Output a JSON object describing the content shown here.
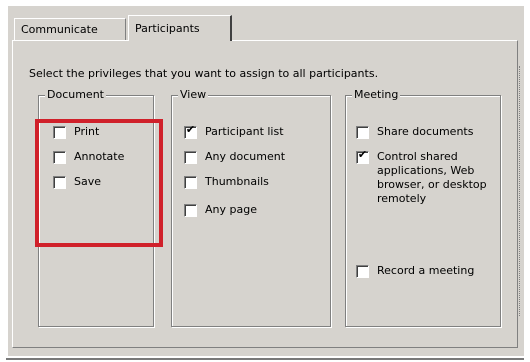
{
  "tabs": [
    {
      "label": "Communicate",
      "selected": false
    },
    {
      "label": "Participants",
      "selected": true
    }
  ],
  "instruction": "Select the privileges that you want to assign to all participants.",
  "groups": {
    "document": {
      "title": "Document",
      "options": [
        {
          "label": "Print",
          "checked": false
        },
        {
          "label": "Annotate",
          "checked": false
        },
        {
          "label": "Save",
          "checked": false
        }
      ]
    },
    "view": {
      "title": "View",
      "options": [
        {
          "label": "Participant list",
          "checked": true
        },
        {
          "label": "Any document",
          "checked": false
        },
        {
          "label": "Thumbnails",
          "checked": false
        },
        {
          "label": "Any page",
          "checked": false
        }
      ]
    },
    "meeting": {
      "title": "Meeting",
      "options": [
        {
          "label": "Share documents",
          "checked": false
        },
        {
          "label": "Control shared applications, Web browser, or desktop remotely",
          "checked": true
        },
        {
          "label": "Record a meeting",
          "checked": false
        }
      ]
    }
  },
  "highlight_color": "#d0202a",
  "icons": {
    "check": "checkmark-icon"
  }
}
